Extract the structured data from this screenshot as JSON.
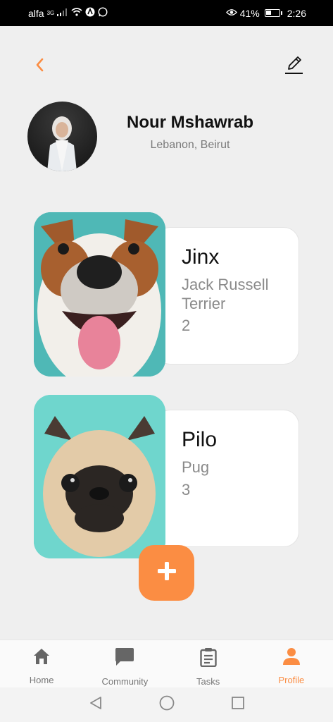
{
  "status_bar": {
    "carrier": "alfa",
    "network": "3G",
    "battery_percent": "41%",
    "time": "2:26"
  },
  "header": {
    "back_icon": "chevron-left-icon",
    "edit_icon": "pencil-icon"
  },
  "profile": {
    "name": "Nour Mshawrab",
    "location": "Lebanon, Beirut"
  },
  "pets": [
    {
      "name": "Jinx",
      "breed": "Jack Russell Terrier",
      "age": "2"
    },
    {
      "name": "Pilo",
      "breed": "Pug",
      "age": "3"
    }
  ],
  "add_button": {
    "icon": "plus-icon"
  },
  "bottom_nav": {
    "items": [
      {
        "label": "Home",
        "icon": "home-icon",
        "active": false
      },
      {
        "label": "Community",
        "icon": "chat-icon",
        "active": false
      },
      {
        "label": "Tasks",
        "icon": "clipboard-icon",
        "active": false
      },
      {
        "label": "Profile",
        "icon": "person-icon",
        "active": true
      }
    ]
  },
  "colors": {
    "accent": "#fb8d43",
    "background": "#efefef",
    "inactive": "#777777"
  }
}
